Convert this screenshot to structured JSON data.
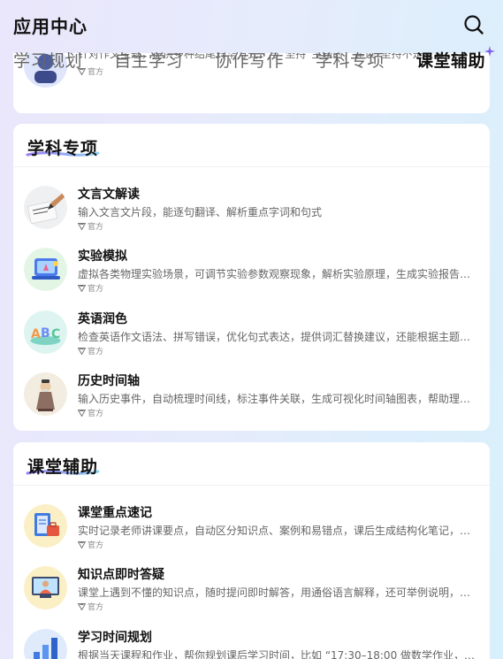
{
  "header": {
    "title": "应用中心",
    "search_icon": "search-icon"
  },
  "tabs": [
    {
      "label": "学习规划",
      "active": false
    },
    {
      "label": "自主学习",
      "active": false
    },
    {
      "label": "协作写作",
      "active": false
    },
    {
      "label": "学科专项",
      "active": false
    },
    {
      "label": "课堂辅助",
      "active": true
    }
  ],
  "previous_item": {
    "desc": "针对作文主题，提供多种结尾升华方式，与“坚持”主题时，建议“坚持不是蒙着…",
    "tag": "官方"
  },
  "sections": [
    {
      "title": "学科专项",
      "items": [
        {
          "name": "文言文解读",
          "desc": "输入文言文片段，能逐句翻译、解析重点字词和句式",
          "tag": "官方",
          "icon": "calligraphy-writing-icon"
        },
        {
          "name": "实验模拟",
          "desc": "虚拟各类物理实验场景，可调节实验参数观察现象，解析实验原理，生成实验报告…",
          "tag": "官方",
          "icon": "lab-experiment-icon"
        },
        {
          "name": "英语润色",
          "desc": "检查英语作文语法、拼写错误，优化句式表达，提供词汇替换建议，还能根据主题…",
          "tag": "官方",
          "icon": "abc-letters-icon"
        },
        {
          "name": "历史时间轴",
          "desc": "输入历史事件，自动梳理时间线，标注事件关联，生成可视化时间轴图表，帮助理…",
          "tag": "官方",
          "icon": "confucius-figure-icon"
        }
      ]
    },
    {
      "title": "课堂辅助",
      "items": [
        {
          "name": "课堂重点速记",
          "desc": "实时记录老师讲课要点，自动区分知识点、案例和易错点，课后生成结构化笔记，…",
          "tag": "官方",
          "icon": "notebook-briefcase-icon"
        },
        {
          "name": "知识点即时答疑",
          "desc": "课堂上遇到不懂的知识点，随时提问即时解答，用通俗语言解释，还可举例说明，…",
          "tag": "官方",
          "icon": "online-teacher-icon"
        },
        {
          "name": "学习时间规划",
          "desc": "根据当天课程和作业，帮你规划课后学习时间，比如 “17:30–18:00 做数学作业，…",
          "tag": "官方",
          "icon": "bar-growth-icon"
        }
      ]
    }
  ],
  "colors": {
    "accent": "#7b5cf0",
    "underline_start": "#9b7cf6",
    "underline_end": "#8fd3f7"
  }
}
